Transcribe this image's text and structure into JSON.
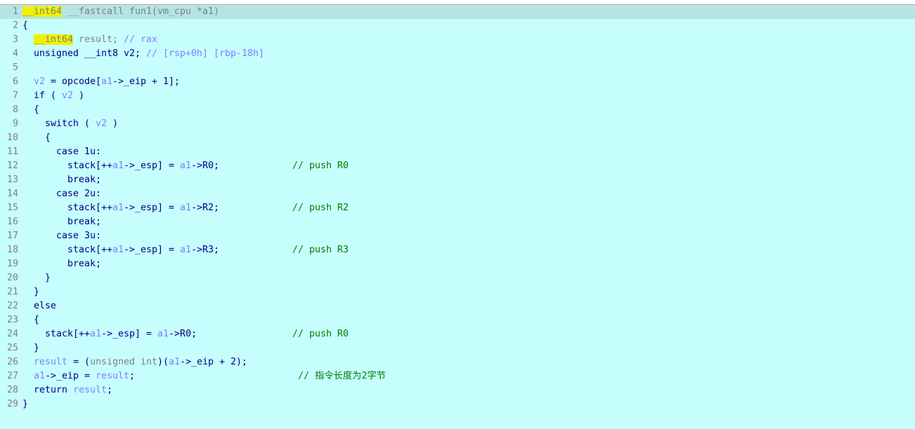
{
  "colors": {
    "background": "#c6fefe",
    "current_line": "#b4e4e4",
    "keyword": "#000080",
    "variable": "#7f7fff",
    "type": "#808080",
    "comment": "#008000",
    "highlight": "#f0f000"
  },
  "lines": [
    [
      [
        "__int64",
        "h"
      ],
      [
        " __fastcall fun1(vm_cpu *a1)",
        "g"
      ]
    ],
    [
      [
        "{",
        "k"
      ]
    ],
    [
      [
        "  ",
        "k"
      ],
      [
        "__int64",
        "h"
      ],
      [
        " result; ",
        "g"
      ],
      [
        "// rax",
        "cb"
      ]
    ],
    [
      [
        "  unsigned __int8 v2; ",
        "k"
      ],
      [
        "// [rsp+0h] [rbp-18h]",
        "cb"
      ]
    ],
    [
      [
        "",
        "k"
      ]
    ],
    [
      [
        "  ",
        "k"
      ],
      [
        "v2",
        "v"
      ],
      [
        " = opcode[",
        "k"
      ],
      [
        "a1",
        "v"
      ],
      [
        "->_eip + 1];",
        "k"
      ]
    ],
    [
      [
        "  if ( ",
        "k"
      ],
      [
        "v2",
        "v"
      ],
      [
        " )",
        "k"
      ]
    ],
    [
      [
        "  {",
        "k"
      ]
    ],
    [
      [
        "    switch ( ",
        "k"
      ],
      [
        "v2",
        "v"
      ],
      [
        " )",
        "k"
      ]
    ],
    [
      [
        "    {",
        "k"
      ]
    ],
    [
      [
        "      case 1u:",
        "k"
      ]
    ],
    [
      [
        "        stack[++",
        "k"
      ],
      [
        "a1",
        "v"
      ],
      [
        "->_esp] = ",
        "k"
      ],
      [
        "a1",
        "v"
      ],
      [
        "->R0;             ",
        "k"
      ],
      [
        "// push R0",
        "c"
      ]
    ],
    [
      [
        "        break;",
        "k"
      ]
    ],
    [
      [
        "      case 2u:",
        "k"
      ]
    ],
    [
      [
        "        stack[++",
        "k"
      ],
      [
        "a1",
        "v"
      ],
      [
        "->_esp] = ",
        "k"
      ],
      [
        "a1",
        "v"
      ],
      [
        "->R2;             ",
        "k"
      ],
      [
        "// push R2",
        "c"
      ]
    ],
    [
      [
        "        break;",
        "k"
      ]
    ],
    [
      [
        "      case 3u:",
        "k"
      ]
    ],
    [
      [
        "        stack[++",
        "k"
      ],
      [
        "a1",
        "v"
      ],
      [
        "->_esp] = ",
        "k"
      ],
      [
        "a1",
        "v"
      ],
      [
        "->R3;             ",
        "k"
      ],
      [
        "// push R3",
        "c"
      ]
    ],
    [
      [
        "        break;",
        "k"
      ]
    ],
    [
      [
        "    }",
        "k"
      ]
    ],
    [
      [
        "  }",
        "k"
      ]
    ],
    [
      [
        "  else",
        "k"
      ]
    ],
    [
      [
        "  {",
        "k"
      ]
    ],
    [
      [
        "    stack[++",
        "k"
      ],
      [
        "a1",
        "v"
      ],
      [
        "->_esp] = ",
        "k"
      ],
      [
        "a1",
        "v"
      ],
      [
        "->R0;                 ",
        "k"
      ],
      [
        "// push R0",
        "c"
      ]
    ],
    [
      [
        "  }",
        "k"
      ]
    ],
    [
      [
        "  ",
        "k"
      ],
      [
        "result",
        "v"
      ],
      [
        " = (",
        "k"
      ],
      [
        "unsigned int",
        "g"
      ],
      [
        ")(",
        "k"
      ],
      [
        "a1",
        "v"
      ],
      [
        "->_eip + 2);",
        "k"
      ]
    ],
    [
      [
        "  ",
        "k"
      ],
      [
        "a1",
        "v"
      ],
      [
        "->_eip = ",
        "k"
      ],
      [
        "result",
        "v"
      ],
      [
        ";                             ",
        "k"
      ],
      [
        "// 指令长度为2字节",
        "c"
      ]
    ],
    [
      [
        "  return ",
        "k"
      ],
      [
        "result",
        "v"
      ],
      [
        ";",
        "k"
      ]
    ],
    [
      [
        "}",
        "k"
      ]
    ]
  ]
}
